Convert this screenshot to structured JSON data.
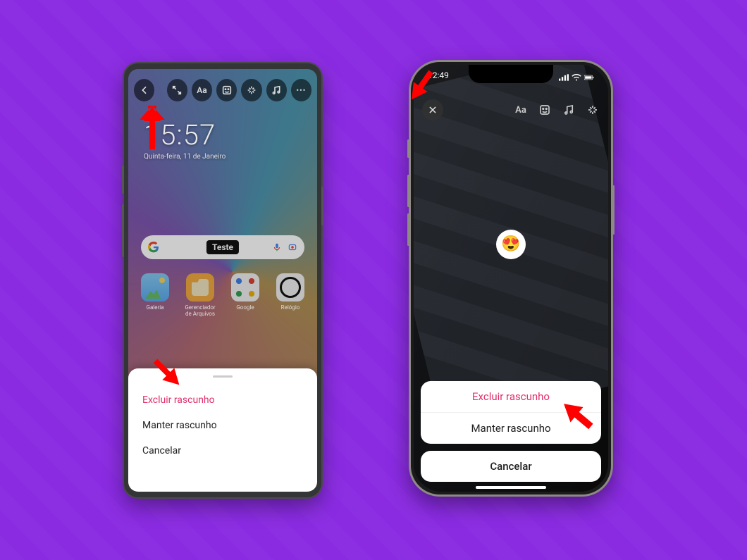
{
  "android": {
    "toolbar": {
      "back": "back",
      "expand": "expand",
      "text": "Aa",
      "sticker": "sticker",
      "effects": "effects",
      "music": "music",
      "more": "more"
    },
    "clock_time": "15:57",
    "clock_date": "Quinta-feira, 11 de Janeiro",
    "search_chip": "Teste",
    "apps": {
      "galeria": "Galeria",
      "files": "Gerenciador de Arquivos",
      "google": "Google",
      "clock": "Relógio"
    },
    "sheet": {
      "delete": "Excluir rascunho",
      "keep": "Manter rascunho",
      "cancel": "Cancelar"
    }
  },
  "ios": {
    "status_time": "12:49",
    "close": "close",
    "tools": {
      "text": "Aa",
      "sticker": "sticker",
      "music": "music",
      "effects": "effects"
    },
    "emoji": "😍",
    "sheet": {
      "delete": "Excluir rascunho",
      "keep": "Manter rascunho",
      "cancel": "Cancelar"
    }
  }
}
